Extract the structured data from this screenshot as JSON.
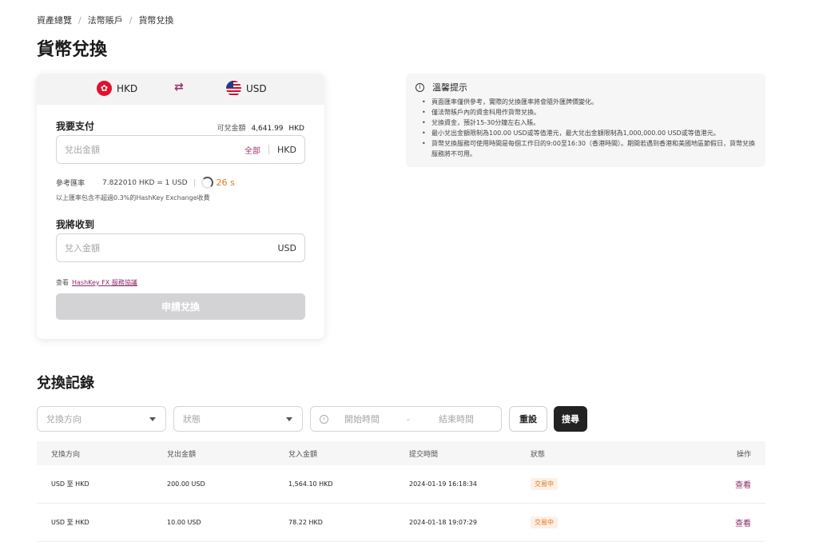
{
  "breadcrumb": [
    "資產總覽",
    "法幣賬戶",
    "貨幣兌換"
  ],
  "page_title": "貨幣兌換",
  "exchange": {
    "from_currency": "HKD",
    "to_currency": "USD",
    "swap_icon": "swap-arrows-icon",
    "pay_label": "我要支付",
    "available_label": "可兌金額",
    "available_amount": "4,641.99",
    "available_unit": "HKD",
    "pay_placeholder": "兌出金額",
    "all_label": "全部",
    "pay_unit": "HKD",
    "rate_label": "參考匯率",
    "rate_value": "7.822010  HKD = 1 USD",
    "countdown": "26 s",
    "fee_note": "以上匯率包含不超過0.3%的HashKey Exchange收費",
    "receive_label": "我將收到",
    "receive_placeholder": "兌入金額",
    "receive_unit": "USD",
    "terms_prefix": "查看",
    "terms_link": "HashKey FX 服務協議",
    "submit_label": "申請兌換"
  },
  "tips": {
    "title": "溫馨提示",
    "items": [
      "頁面匯率僅供參考，實際的兌換匯率將會隨外匯牌價變化。",
      "僅法幣賬戶內的資金科用作貨幣兌換。",
      "兌換資金，預計15-30分鐘左右入賬。",
      "最小兌出金額限制為100.00 USD或等值港元，最大兌出金額限制為1,000,000.00 USD或等值港元。",
      "貨幣兌換服務可使用時間是每個工作日的9:00至16:30（香港時間）。期間若遇到香港和美國地區節假日，貨幣兌換服務將不可用。"
    ]
  },
  "records": {
    "title": "兌換記錄",
    "filter_direction_placeholder": "兌換方向",
    "filter_status_placeholder": "狀態",
    "start_time_placeholder": "開始時間",
    "date_separator": "-",
    "end_time_placeholder": "結束時間",
    "reset_label": "重設",
    "search_label": "搜尋",
    "columns": [
      "兌換方向",
      "兌出金額",
      "兌入金額",
      "提交時間",
      "狀態",
      "操作"
    ],
    "rows": [
      {
        "direction": "USD 至 HKD",
        "out": "200.00 USD",
        "in": "1,564.10 HKD",
        "time": "2024-01-19 16:18:34",
        "status": "交易中",
        "action": "查看"
      },
      {
        "direction": "USD 至 HKD",
        "out": "10.00 USD",
        "in": "78.22 HKD",
        "time": "2024-01-18 19:07:29",
        "status": "交易中",
        "action": "查看"
      }
    ]
  },
  "colors": {
    "accent": "#8c2a6a",
    "status_pending": "#d9772a",
    "countdown": "#e0781a"
  }
}
